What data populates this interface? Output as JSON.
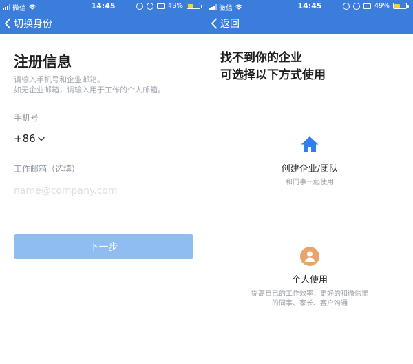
{
  "status_left": {
    "carrier": "微信",
    "time": "14:45",
    "battery": "49%"
  },
  "status_right": {
    "carrier": "微信",
    "time": "14:45",
    "battery": "49%"
  },
  "left": {
    "back_label": "切换身份",
    "title": "注册信息",
    "subtitle_line1": "请输入手机号和企业邮箱。",
    "subtitle_line2": "如无企业邮箱，请输入用于工作的个人邮箱。",
    "phone_label": "手机号",
    "country_code": "+86",
    "email_label": "工作邮箱（选填）",
    "email_placeholder": "name@company.com",
    "email_value": "",
    "next_label": "下一步"
  },
  "right": {
    "back_label": "返回",
    "title_line1": "找不到你的企业",
    "title_line2": "可选择以下方式使用",
    "option_team": {
      "name": "创建企业/团队",
      "desc": "和同事一起使用",
      "icon": "house-icon"
    },
    "option_personal": {
      "name": "个人使用",
      "desc_line1": "提高自己的工作效率，更好的和微信里",
      "desc_line2": "的同事、家长、客户沟通",
      "icon": "person-icon"
    }
  },
  "colors": {
    "header": "#3b7ddb",
    "button_disabled": "#8fbcf1",
    "house": "#2f80ed",
    "person_bg": "#e9a46a"
  }
}
